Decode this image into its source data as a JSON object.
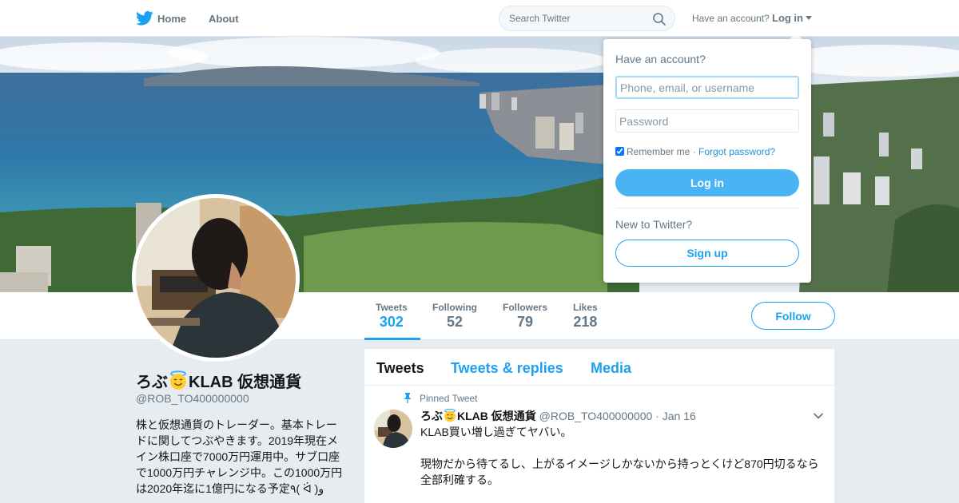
{
  "nav": {
    "home": "Home",
    "about": "About",
    "search_placeholder": "Search Twitter",
    "have_account": "Have an account?",
    "login": "Log in"
  },
  "profile": {
    "name_part1": "ろぶ",
    "name_part2": "KLAB 仮想通貨",
    "handle": "@ROB_TO400000000",
    "bio": "株と仮想通貨のトレーダー。基本トレードに関してつぶやきます。2019年現在メイン株口座で7000万円運用中。サブ口座で1000万円チャレンジ中。この1000万円は2020年迄に1億円になる予定٩( ᐛ )و",
    "follow_label": "Follow"
  },
  "stats": [
    {
      "label": "Tweets",
      "value": "302"
    },
    {
      "label": "Following",
      "value": "52"
    },
    {
      "label": "Followers",
      "value": "79"
    },
    {
      "label": "Likes",
      "value": "218"
    }
  ],
  "timeline": {
    "tabs": [
      "Tweets",
      "Tweets & replies",
      "Media"
    ],
    "pinned_label": "Pinned Tweet",
    "tweet": {
      "name_part1": "ろぶ",
      "name_part2": "KLAB 仮想通貨",
      "handle": "@ROB_TO400000000",
      "separator": "·",
      "date": "Jan 16",
      "line1": "KLAB買い増し過ぎてヤバい。",
      "line2": "現物だから待てるし、上がるイメージしかないから持っとくけど870円切るなら全部利確する。"
    }
  },
  "login_dropdown": {
    "title": "Have an account?",
    "username_placeholder": "Phone, email, or username",
    "password_placeholder": "Password",
    "remember": "Remember me",
    "separator": "·",
    "forgot": "Forgot password?",
    "login_button": "Log in",
    "new_to": "New to Twitter?",
    "signup_button": "Sign up"
  },
  "colors": {
    "accent": "#1da1f2",
    "background": "#e6ecf0",
    "muted": "#657786"
  },
  "icons": [
    "twitter-bird-icon",
    "search-icon",
    "caret-down-icon",
    "pin-icon",
    "halo-emoji-icon",
    "chevron-down-icon"
  ]
}
